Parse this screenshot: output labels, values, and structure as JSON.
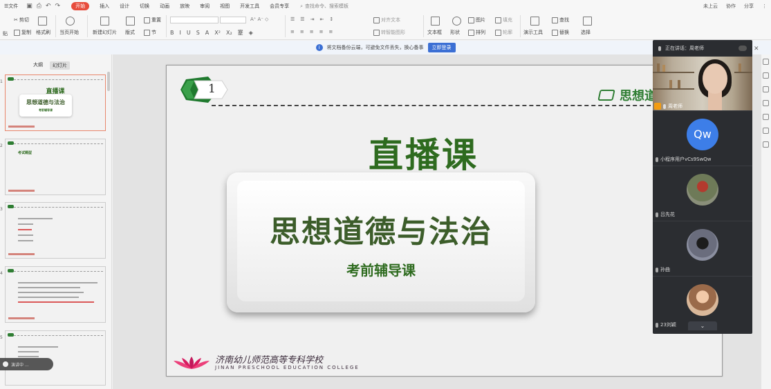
{
  "menubar": {
    "file_label": "文件",
    "tabs": [
      "开始",
      "插入",
      "设计",
      "切换",
      "动画",
      "放映",
      "审阅",
      "视图",
      "开发工具",
      "会员专享"
    ],
    "active_tab": "开始",
    "search_text": "查找命令、搜索模板",
    "right": [
      "未上云",
      "协作",
      "分享"
    ]
  },
  "ribbon": {
    "cut": "剪切",
    "copy": "复制",
    "format_painter": "格式刷",
    "paste": "贴",
    "from_current": "当页开始",
    "new_slide": "新建幻灯片",
    "layout": "版式",
    "section": "节",
    "reset": "重置",
    "align_text": "对齐文本",
    "convert_smartart": "转智能图形",
    "textbox": "文本框",
    "shape": "形状",
    "picture": "图片",
    "arrange": "排列",
    "fill": "填充",
    "outline": "轮廓",
    "presentation_tools": "演示工具",
    "find": "查找",
    "replace": "替换",
    "select": "选择"
  },
  "notice": {
    "text": "将文档备份云端，可避免文件丢失，换心备事",
    "button": "立即登录"
  },
  "left_panel": {
    "tab_outline": "大纲",
    "tab_slides": "幻灯片",
    "thumbs": [
      {
        "num": "1",
        "title": "直播课",
        "subtitle": "思想道德与法治",
        "line": "考前辅导课"
      },
      {
        "num": "2",
        "title": "考试题型"
      },
      {
        "num": "3"
      },
      {
        "num": "4"
      },
      {
        "num": "5"
      }
    ],
    "live_text": "演讲中 ..."
  },
  "slide": {
    "badge_number": "1",
    "brand": "思想道",
    "title": "直播课",
    "subtitle": "思想道德与法治",
    "tagline": "考前辅导课",
    "school_cn": "济南幼儿师范高等专科学校",
    "school_en": "JINAN PRESCHOOL EDUCATION COLLEGE"
  },
  "video_panel": {
    "speaking": "正在讲话：周老师",
    "teacher_name": "周老师",
    "participants": [
      {
        "name": "小程序用户vCs9SwQw",
        "avatar_text": "Qw"
      },
      {
        "name": "吕先花"
      },
      {
        "name": "孙曲"
      },
      {
        "name": "23刘颖"
      }
    ]
  },
  "colors": {
    "accent_red": "#e74c3c",
    "slide_green": "#2e6b1f",
    "login_blue": "#3b6fd4",
    "video_bg": "#2b2d31",
    "avatar_blue": "#3d7ee8"
  },
  "icons": [
    "search-icon",
    "cut-icon",
    "copy-icon",
    "paste-icon",
    "mic-icon",
    "chevron-down-icon",
    "close-icon",
    "info-icon"
  ]
}
